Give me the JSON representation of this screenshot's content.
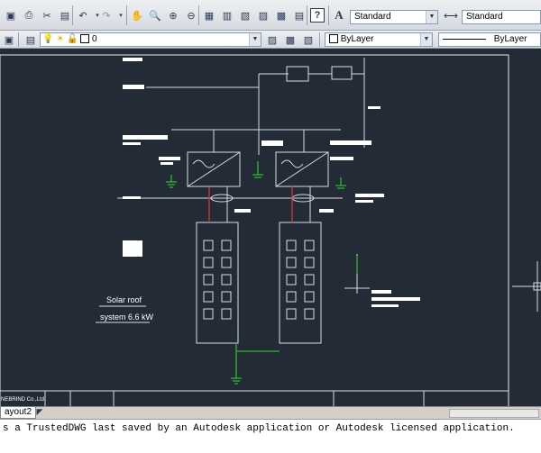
{
  "toolbar": {
    "text_style_value": "Standard",
    "dim_style_value": "Standard",
    "layer_value": "0",
    "color_value": "ByLayer",
    "linetype_value": "ByLayer",
    "help_glyph": "?"
  },
  "drawing": {
    "label_solar_roof": "Solar roof",
    "label_system": "system 6.6 kW",
    "title_block_company": "NEBRIND Co.,Ltd."
  },
  "layout_tabs": [
    {
      "label": "ayout2"
    }
  ],
  "command_line": {
    "message": "s a TrustedDWG last saved by an Autodesk application or Autodesk licensed application."
  },
  "colors": {
    "canvas_bg": "#222b36",
    "wire": "#d9dde3",
    "ground": "#2fb52f",
    "red": "#e03030"
  }
}
